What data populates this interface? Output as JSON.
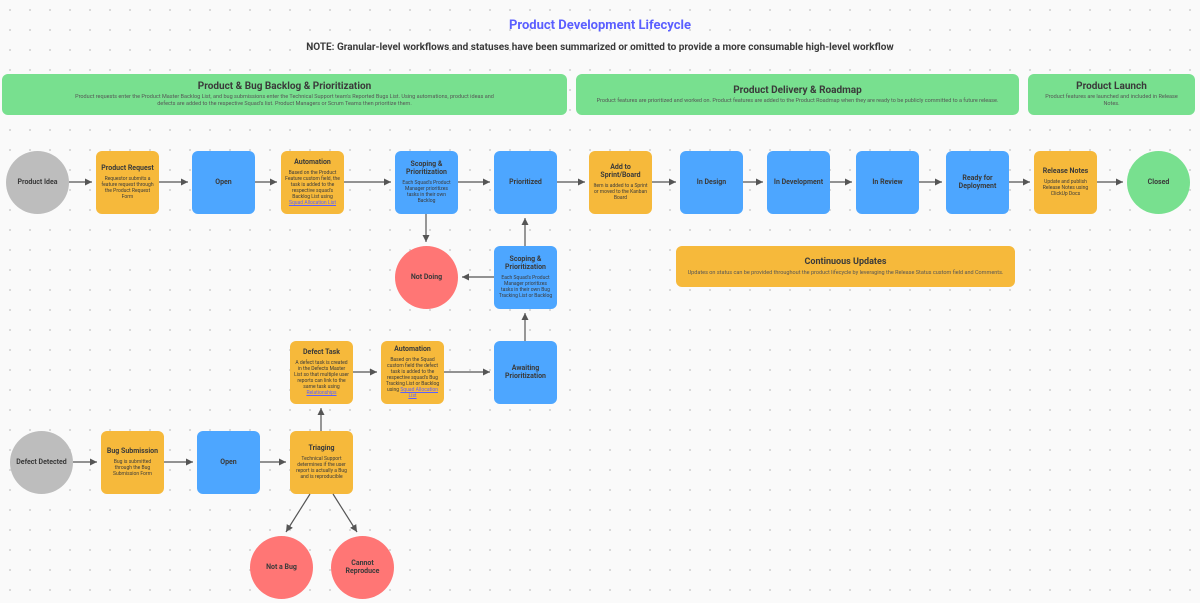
{
  "title": "Product Development Lifecycle",
  "subtitle": "NOTE: Granular-level workflows and statuses have been summarized or omitted to provide a more consumable high-level workflow",
  "phases": {
    "p1": {
      "title": "Product & Bug Backlog & Prioritization",
      "desc": "Product requests enter the Product Master Backlog List, and bug submissions enter the Technical Support team's Reported Bugs List. Using automations, product ideas and defects are added to the respective Squad's list. Product Managers or Scrum Teams then prioritize them."
    },
    "p2": {
      "title": "Product Delivery & Roadmap",
      "desc": "Product features are prioritized and worked on. Product features are added to the Product Roadmap when they are ready to be publicly committed to a future release."
    },
    "p3": {
      "title": "Product Launch",
      "desc": "Product features are launched and included in Release Notes."
    }
  },
  "nodes": {
    "idea": {
      "label": "Product Idea"
    },
    "prodreq": {
      "label": "Product Request",
      "desc": "Requestor submits a feature request through the Product Request Form"
    },
    "open1": {
      "label": "Open"
    },
    "auto1": {
      "label": "Automation",
      "desc": "Based on the Product Feature custom field, the task is added to the respective squad's Backlog List using ",
      "link": "Squad Allocation List"
    },
    "scope1": {
      "label": "Scoping & Prioritization",
      "desc": "Each Squad's Product Manager prioritizes tasks in their own Backlog"
    },
    "prioritized": {
      "label": "Prioritized"
    },
    "sprint": {
      "label": "Add to Sprint/Board",
      "desc": "Item is added to a Sprint or moved to the Kanban Board"
    },
    "design": {
      "label": "In Design"
    },
    "dev": {
      "label": "In Development"
    },
    "review": {
      "label": "In Review"
    },
    "ready": {
      "label": "Ready for Deployment"
    },
    "release": {
      "label": "Release Notes",
      "desc": "Update and publish Release Notes using ClickUp Docs"
    },
    "closed": {
      "label": "Closed"
    },
    "notdoing": {
      "label": "Not Doing"
    },
    "scope2": {
      "label": "Scoping & Prioritization",
      "desc": "Each Squad's Product Manager prioritizes tasks in their own Bug Tracking List or Backlog"
    },
    "defecttask": {
      "label": "Defect Task",
      "desc": "A defect task is created in the Defects Master List so that multiple user reports can link to the same task using ",
      "link": "Relationships"
    },
    "auto2": {
      "label": "Automation",
      "desc": "Based on the Squad custom field the defect task is added to the respective squad's Bug Tracking List or Backlog using ",
      "link": "Squad Allocation List"
    },
    "awaiting": {
      "label": "Awaiting Prioritization"
    },
    "defect": {
      "label": "Defect Detected"
    },
    "bugsub": {
      "label": "Bug Submission",
      "desc": "Bug is submitted through the Bug Submission Form"
    },
    "open2": {
      "label": "Open"
    },
    "triaging": {
      "label": "Triaging",
      "desc": "Technical Support determines if the user report is actually a Bug and is reproducible"
    },
    "notbug": {
      "label": "Not a Bug"
    },
    "cannot": {
      "label": "Cannot Reproduce"
    }
  },
  "continuous": {
    "title": "Continuous Updates",
    "desc": "Updates on status can be provided throughout the product lifecycle by leveraging the Release Status custom field and Comments."
  }
}
